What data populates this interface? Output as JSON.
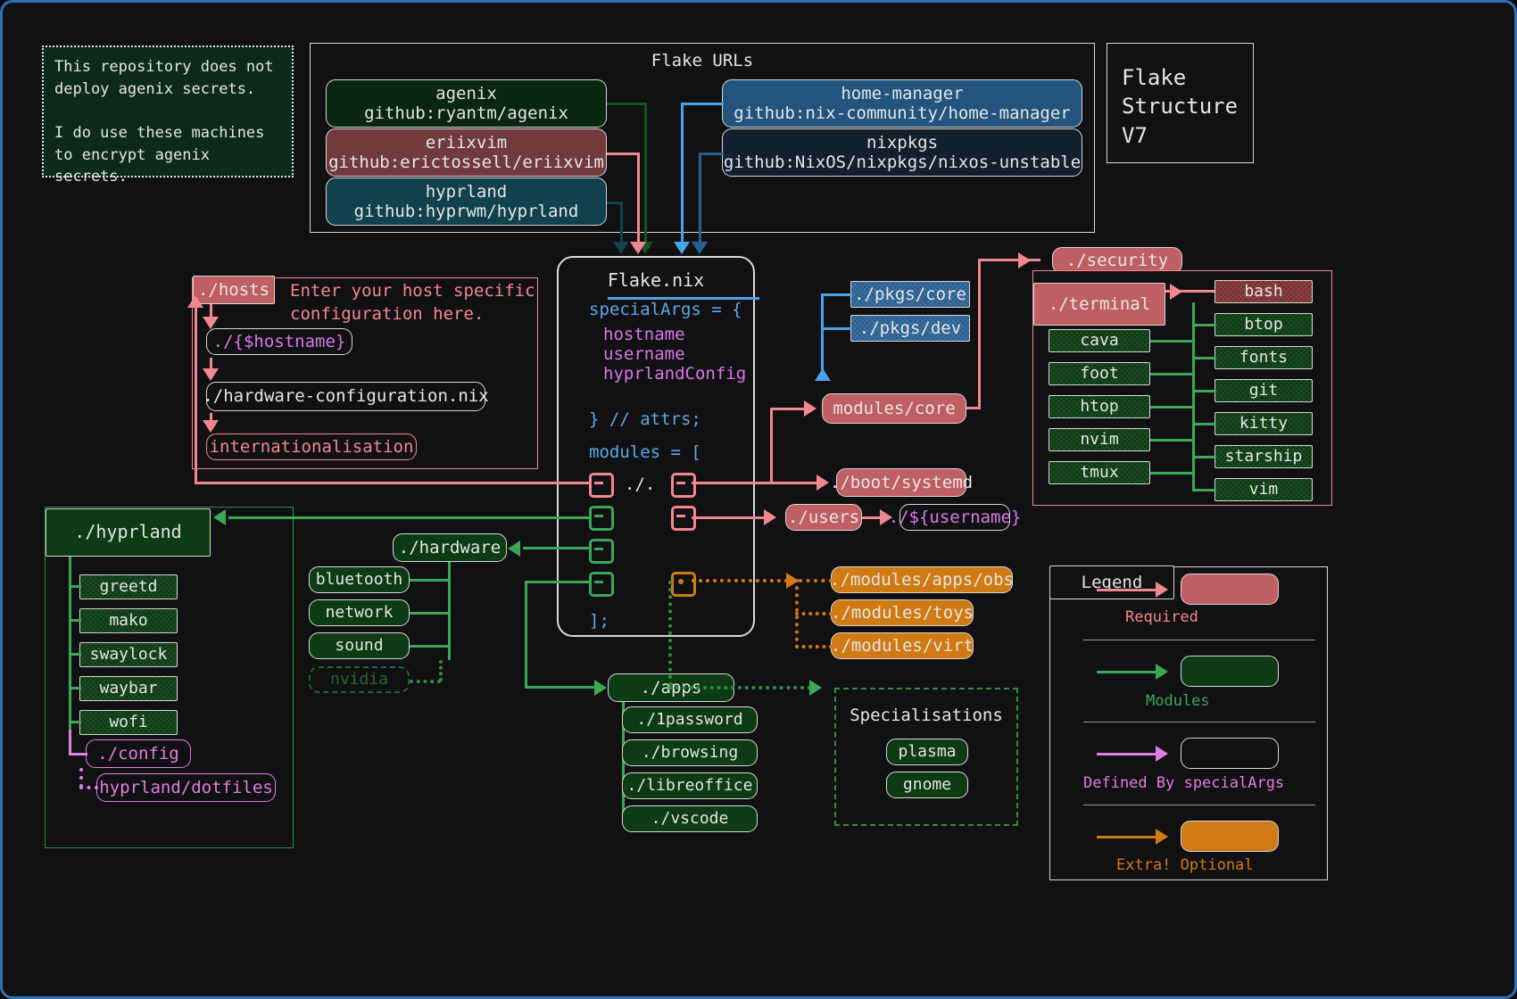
{
  "title_card": {
    "lines": "Flake\nStructure\nV7"
  },
  "note": {
    "text": "This repository does not\ndeploy agenix secrets.\n\nI do use these machines\nto encrypt agenix\nsecrets."
  },
  "flake_urls": {
    "panel_title": "Flake URLs",
    "inputs": [
      {
        "name": "agenix",
        "url": "github:ryantm/agenix",
        "skin": "dkgrn"
      },
      {
        "name": "eriixvim",
        "url": "github:erictossell/eriixvim",
        "skin": "maroon"
      },
      {
        "name": "hyprland",
        "url": "github:hyprwm/hyprland",
        "skin": "teal"
      },
      {
        "name": "home-manager",
        "url": "github:nix-community/home-manager",
        "skin": "midblue"
      },
      {
        "name": "nixpkgs",
        "url": "github:NixOS/nixpkgs/nixos-unstable",
        "skin": "darkblue"
      }
    ]
  },
  "flake_nix": {
    "title": "Flake.nix",
    "code": {
      "special_args": "specialArgs = {",
      "args": [
        "hostname",
        "username",
        "hyprlandConfig"
      ],
      "attrs": "} // attrs;",
      "modules_open": "modules = [",
      "self_path": "./.",
      "modules_close": "];"
    }
  },
  "hosts": {
    "label": "./hosts",
    "hint": "Enter your host specific\nconfiguration here.",
    "children": [
      {
        "label": "./{$hostname}",
        "skin": "violet-box"
      },
      {
        "label": "./hardware-configuration.nix",
        "skin": "plain"
      },
      {
        "label": "internationalisation",
        "skin": "redline"
      }
    ]
  },
  "pkgs": [
    "./pkgs/core",
    "./pkgs/dev"
  ],
  "modules_core": "modules/core",
  "boot_systemd": "./boot/systemd",
  "users": {
    "label": "./users",
    "child": "./${username}"
  },
  "security": "./security",
  "terminal": {
    "label": "./terminal",
    "left_items": [
      "cava",
      "foot",
      "htop",
      "nvim",
      "tmux"
    ],
    "right_items": [
      "bash",
      "btop",
      "fonts",
      "git",
      "kitty",
      "starship",
      "vim"
    ]
  },
  "hyprland": {
    "label": "./hyprland",
    "items": [
      "greetd",
      "mako",
      "swaylock",
      "waybar",
      "wofi"
    ],
    "config": "./config",
    "dotfiles": "hyprland/dotfiles"
  },
  "hardware": {
    "label": "./hardware",
    "items": [
      "bluetooth",
      "network",
      "sound"
    ],
    "optional": "nvidia"
  },
  "apps": {
    "label": "./apps",
    "items": [
      "./1password",
      "./browsing",
      "./libreoffice",
      "./vscode"
    ]
  },
  "extra_modules": [
    "./modules/apps/obs",
    "./modules/toys",
    "./modules/virt"
  ],
  "specialisations": {
    "title": "Specialisations",
    "items": [
      "plasma",
      "gnome"
    ]
  },
  "legend": {
    "title": "Legend",
    "entries": [
      {
        "caption": "Required",
        "color": "#f2888d"
      },
      {
        "caption": "Modules",
        "color": "#3aa855"
      },
      {
        "caption": "Defined By specialArgs",
        "color": "#e07fe0"
      },
      {
        "caption": "Extra! Optional",
        "color": "#cf7a12"
      }
    ]
  },
  "colors": {
    "required": "#f2888d",
    "modules": "#3aa855",
    "special_args": "#e07fe0",
    "optional": "#cf7a12",
    "frame": "#2f6fb5"
  }
}
